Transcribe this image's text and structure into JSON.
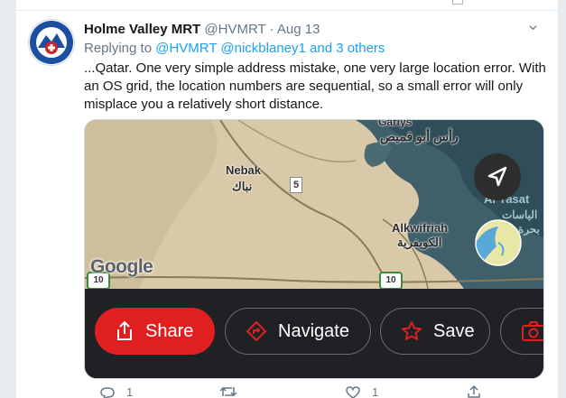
{
  "tweet": {
    "display_name": "Holme Valley MRT",
    "handle": "@HVMRT",
    "separator": "·",
    "date": "Aug 13",
    "replying_prefix": "Replying to",
    "replying_to": "@HVMRT @nickblaney1 and 3 others",
    "text": "...Qatar. One very simple address mistake, one very large location error. With an OS grid, the location numbers are sequential, so a small error will only misplace you a relatively short distance."
  },
  "map": {
    "labels": {
      "gariyeh_top": "Gariys",
      "ras_abu": "رأس أبو قميص",
      "nebak": "Nebak",
      "nebak_ar": "نباك",
      "alkwifriah": "Alkwifriah",
      "alkwifriah_ar": "الكويفرية",
      "al_yasat": "Al Yasat",
      "al_yasat_ar": "الياسات",
      "bahr": "بحرة",
      "route_5": "5",
      "road_10_left": "10",
      "road_10_right": "10"
    },
    "attribution": "Google"
  },
  "action_bar": {
    "share": "Share",
    "navigate": "Navigate",
    "save": "Save"
  },
  "tweet_actions": {
    "reply_count": "1",
    "like_count": "1"
  },
  "colors": {
    "share_red": "#e02020",
    "link_blue": "#1da1f2",
    "muted_gray": "#657786"
  }
}
